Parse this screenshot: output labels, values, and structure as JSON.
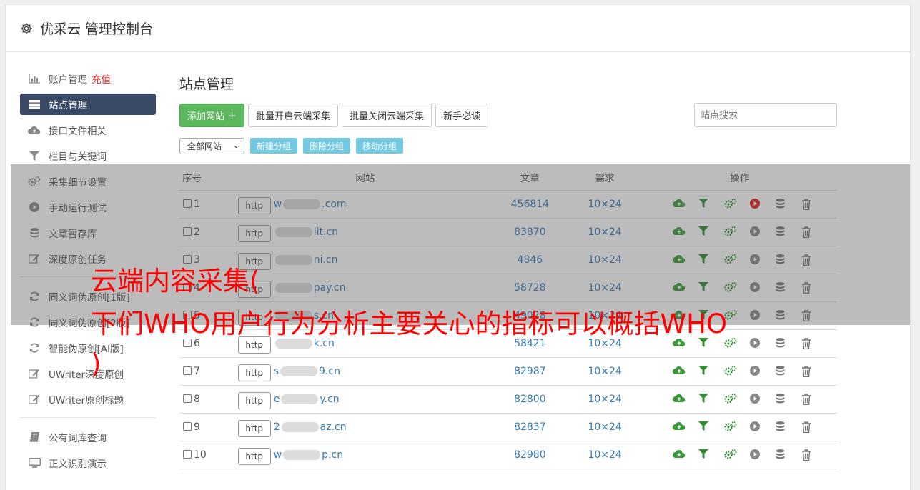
{
  "app": {
    "title": "优采云 管理控制台"
  },
  "sidebar": {
    "group1": [
      {
        "label": "账户管理",
        "extra": "充值",
        "icon": "bar-chart-icon",
        "active": false
      },
      {
        "label": "站点管理",
        "icon": "server-icon",
        "active": true
      },
      {
        "label": "接口文件相关",
        "icon": "cloud-upload-icon",
        "active": false
      },
      {
        "label": "栏目与关键词",
        "icon": "filter-icon",
        "active": false
      },
      {
        "label": "采集细节设置",
        "icon": "cogs-icon",
        "active": false
      },
      {
        "label": "手动运行测试",
        "icon": "play-circle-icon",
        "active": false
      },
      {
        "label": "文章暂存库",
        "icon": "database-icon",
        "active": false
      },
      {
        "label": "深度原创任务",
        "icon": "edit-icon",
        "active": false
      }
    ],
    "group2": [
      {
        "label": "同义词伪原创[1版]",
        "icon": "refresh-icon"
      },
      {
        "label": "同义词伪原创[2版]",
        "icon": "refresh-icon"
      },
      {
        "label": "智能伪原创[AI版]",
        "icon": "refresh-icon"
      },
      {
        "label": "UWriter深度原创",
        "icon": "edit-icon"
      },
      {
        "label": "UWriter原创标题",
        "icon": "edit-icon"
      }
    ],
    "group3": [
      {
        "label": "公有词库查询",
        "icon": "book-icon"
      },
      {
        "label": "正文识别演示",
        "icon": "monitor-icon"
      }
    ]
  },
  "main": {
    "title": "站点管理",
    "toolbar": {
      "add_site": "添加网站 ＋",
      "batch_open": "批量开启云端采集",
      "batch_close": "批量关闭云端采集",
      "newbie": "新手必读",
      "search_placeholder": "站点搜索"
    },
    "group_select": "全部网站",
    "group_buttons": {
      "new": "新建分组",
      "delete": "删除分组",
      "move": "移动分组"
    },
    "table": {
      "headers": {
        "index": "序号",
        "site": "网站",
        "articles": "文章",
        "need": "需求",
        "ops": "操作"
      },
      "rows": [
        {
          "index": "1",
          "prefix": "w",
          "suffix": ".com",
          "articles": "456814",
          "need": "10×24",
          "play_active": true
        },
        {
          "index": "2",
          "prefix": "",
          "suffix": "lit.cn",
          "articles": "83870",
          "need": "10×24",
          "play_active": false
        },
        {
          "index": "3",
          "prefix": "",
          "suffix": "ni.cn",
          "articles": "4846",
          "need": "10×24",
          "play_active": false
        },
        {
          "index": "4",
          "prefix": "",
          "suffix": "pay.cn",
          "articles": "58728",
          "need": "10×24",
          "play_active": false
        },
        {
          "index": "5",
          "prefix": "",
          "suffix": "s.cn",
          "articles": "49028",
          "need": "10×24",
          "play_active": false
        },
        {
          "index": "6",
          "prefix": "",
          "suffix": "k.cn",
          "articles": "58421",
          "need": "10×24",
          "play_active": false
        },
        {
          "index": "7",
          "prefix": "s",
          "suffix": "9.cn",
          "articles": "82987",
          "need": "10×24",
          "play_active": false
        },
        {
          "index": "8",
          "prefix": "e",
          "suffix": "y.cn",
          "articles": "82800",
          "need": "10×24",
          "play_active": false
        },
        {
          "index": "9",
          "prefix": "2",
          "suffix": "az.cn",
          "articles": "82837",
          "need": "10×24",
          "play_active": false
        },
        {
          "index": "10",
          "prefix": "w",
          "suffix": "p.cn",
          "articles": "82980",
          "need": "10×24",
          "play_active": false
        }
      ],
      "http_label": "http"
    }
  },
  "overlay": {
    "line1": "云端内容采集(",
    "line2": "下们WHO用户行为分析主要关心的指标可以概括WHO",
    "line3": ")"
  },
  "colors": {
    "active_nav": "#3a4a66",
    "green": "#5cb85c",
    "link": "#337ab7",
    "overlay_text": "#ff0000"
  }
}
